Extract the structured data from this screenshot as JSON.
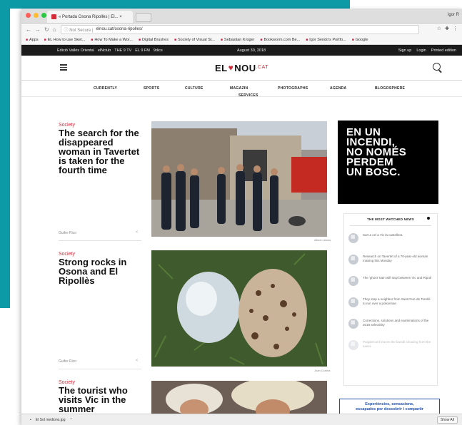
{
  "browser": {
    "tab_title": "« Portada Osona Ripollès | El... ×",
    "tab_close": "×",
    "user_label": "Igor R",
    "url_prefix": "ⓘ Not Secure |",
    "url": "elnou.cat/osona-ripolles/",
    "bookmarks": [
      "Apps",
      "EL How to use Sket...",
      "How To Make a Wor...",
      "Digital Brushes",
      "Society of Visual St...",
      "Sebastian Krüger",
      "Bookworm.com Be...",
      "Igor Sendo's Portfo...",
      "Google"
    ]
  },
  "site": {
    "top_links": [
      "Edició Vallès Oriental",
      "elNclub",
      "THE 9 TV",
      "EL 9 FM",
      "9dics"
    ],
    "date": "August 30, 2018",
    "sign_up": "Sign up",
    "login": "Login",
    "printed": "Printed edition",
    "logo_left": "EL",
    "logo_heart": "♥",
    "logo_mid": "NOU",
    "logo_right": ".CAT",
    "nav": [
      "CURRENTLY",
      "SPORTS",
      "CULTURE",
      "MAGAZIN",
      "PHOTOGRAPHS",
      "AGENDA",
      "BLOGOSPHERE"
    ],
    "nav_services": "SERVICES"
  },
  "stories": [
    {
      "category": "Society",
      "headline": "The search for the disappeared woman in Tavertet is taken for the fourth time",
      "author": "Guifre Rico",
      "credit": "Albert Llimós"
    },
    {
      "category": "Society",
      "headline": "Strong rocks in Osona and El Ripollès",
      "author": "Guifre Rico",
      "credit": "Joan Codina"
    },
    {
      "category": "Society",
      "headline": "The tourist who visits Vic in the summer",
      "author": "",
      "credit": ""
    }
  ],
  "ad_lines": [
    "EN UN",
    "INCENDI,",
    "NO NOMÉS",
    "PERDEM",
    "UN BOSC."
  ],
  "most_watched": {
    "title": "THE MOST WATCHED NEWS",
    "items": [
      "Surt a cel a Vic la castellera",
      "Research on Tavertet of a 70-year-old woman missing this Monday",
      "The 'ghost' train will stop between Vic and Ripoll",
      "They stop a neighbor from Sant Pere de Torelló to run over a policeman",
      "Corrections, solutions and examinations of the 2018 selectivity",
      "Puigdemont leaves the bandit shouting from the towns"
    ]
  },
  "promo": {
    "line1": "Experiències, sensacions,",
    "line2": "escapades per descobrir i compartir"
  },
  "download": {
    "filename": "El Sol mediono.jpg",
    "show_all": "Show All"
  },
  "colors": {
    "accent": "#d02c3a",
    "teal": "#0d9aa7",
    "sitebar": "#1b1b1b",
    "promo": "#1f4fa8"
  }
}
